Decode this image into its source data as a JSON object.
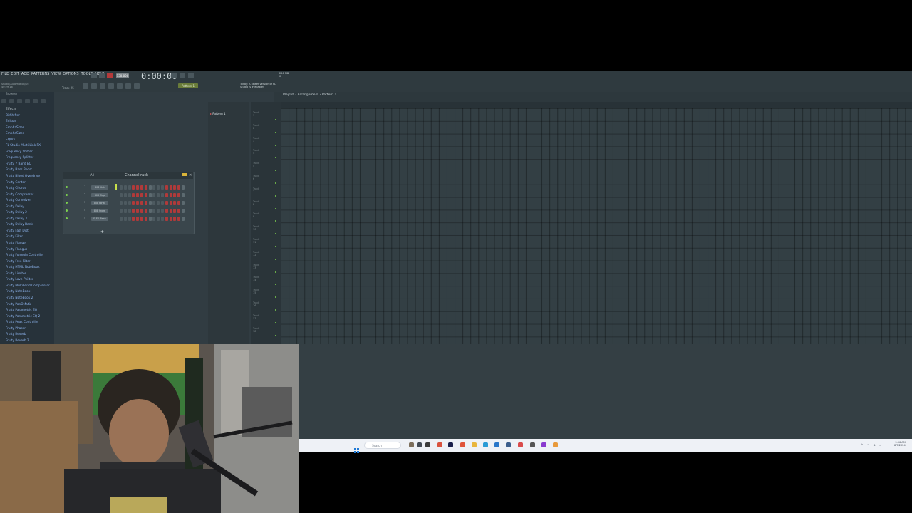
{
  "menu": [
    "FILE",
    "EDIT",
    "ADD",
    "PATTERNS",
    "VIEW",
    "OPTIONS",
    "TOOLS",
    "HELP"
  ],
  "transport": {
    "time": "0:00:00",
    "tempo": "130.000"
  },
  "toolbar": {
    "pattern": "Pattern 1",
    "notice": "Today: A newer version of FL Studio is available!",
    "hint": "Studio/Automation/Ui",
    "hint2": "40:29:16",
    "track": "Track 25",
    "cpu": "256 MB",
    "cpu2": "0"
  },
  "browser": {
    "title": "Browser",
    "items": [
      "Effects",
      "BitShifter",
      "Edison",
      "EmphaSizer",
      "EmphaSizer",
      "EQUO",
      "FL Studio Multi-Link FX",
      "Frequency Shifter",
      "Frequency Splitter",
      "Fruity 7 Band EQ",
      "Fruity Bass Boost",
      "Fruity Blood Overdrive",
      "Fruity Center",
      "Fruity Chorus",
      "Fruity Compressor",
      "Fruity Convolver",
      "Fruity Delay",
      "Fruity Delay 2",
      "Fruity Delay 3",
      "Fruity Delay Bank",
      "Fruity Fast Dist",
      "Fruity Filter",
      "Fruity Flanger",
      "Fruity Flangus",
      "Fruity Formula Controller",
      "Fruity Free Filter",
      "Fruity HTML NoteBook",
      "Fruity Limiter",
      "Fruity Love Philter",
      "Fruity Multiband Compressor",
      "Fruity NoteBook",
      "Fruity NoteBook 2",
      "Fruity PanOMatic",
      "Fruity Parametric EQ",
      "Fruity Parametric EQ 2",
      "Fruity Peak Controller",
      "Fruity Phaser",
      "Fruity Reverb",
      "Fruity Reverb 2"
    ]
  },
  "channel_rack": {
    "title": "Channel rack",
    "filter": "All",
    "channels": [
      {
        "num": "1",
        "name": "808 Kick"
      },
      {
        "num": "2",
        "name": "808 Clap"
      },
      {
        "num": "3",
        "name": "808 HiHat"
      },
      {
        "num": "4",
        "name": "808 Snare"
      },
      {
        "num": "5",
        "name": "FLEX Piano"
      }
    ],
    "add": "+"
  },
  "patterns": {
    "items": [
      "Pattern 1"
    ]
  },
  "playlist": {
    "title": "Playlist - Arrangement › Pattern 1",
    "tracks": [
      "Track 1",
      "Track 2",
      "Track 3",
      "Track 4",
      "Track 5",
      "Track 6",
      "Track 7",
      "Track 8",
      "Track 9",
      "Track 10",
      "Track 11",
      "Track 12",
      "Track 13",
      "Track 14",
      "Track 15",
      "Track 16",
      "Track 17",
      "Track 18"
    ]
  },
  "taskbar": {
    "search": "Search",
    "time": "3:06 AM",
    "date": "8/7/2024",
    "tray": "^ ◠ ⊕ ◁"
  },
  "colors": {
    "accent_green": "#7cd04e",
    "step_red": "#b03a3a",
    "pattern_green": "#6a7c3a"
  }
}
